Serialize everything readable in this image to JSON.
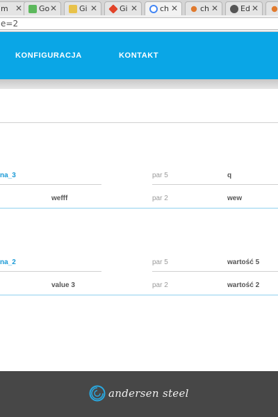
{
  "browser": {
    "tabs": [
      {
        "title": "m",
        "favicon_color": "#777777"
      },
      {
        "title": "Go",
        "favicon_color": "#5cb85c"
      },
      {
        "title": "Gi",
        "favicon_color": "#e8c24a"
      },
      {
        "title": "Gi",
        "favicon_color": "#e24329"
      },
      {
        "title": "ch",
        "favicon_color": "#4285f4"
      },
      {
        "title": "ch",
        "favicon_color": "#e07a2e"
      },
      {
        "title": "Ed",
        "favicon_color": "#555555"
      },
      {
        "title": "",
        "favicon_color": "#e07a2e"
      }
    ],
    "close_glyph": "✕",
    "url": "e=2"
  },
  "nav": {
    "items": [
      "KONFIGURACJA",
      "KONTAKT"
    ],
    "bg_color": "#0aa6e6"
  },
  "cards": [
    {
      "title": "na_3",
      "left_value": "wefff",
      "pairs": [
        {
          "key": "par 5",
          "value": "q"
        },
        {
          "key": "par 2",
          "value": "wew"
        }
      ]
    },
    {
      "title": "na_2",
      "left_value": "value 3",
      "pairs": [
        {
          "key": "par 5",
          "value": "wartość 5"
        },
        {
          "key": "par 2",
          "value": "wartość 2"
        }
      ]
    }
  ],
  "footer": {
    "brand": "andersen steel",
    "bg_color": "#474747",
    "logo_icon": "spiral-logo-icon"
  }
}
